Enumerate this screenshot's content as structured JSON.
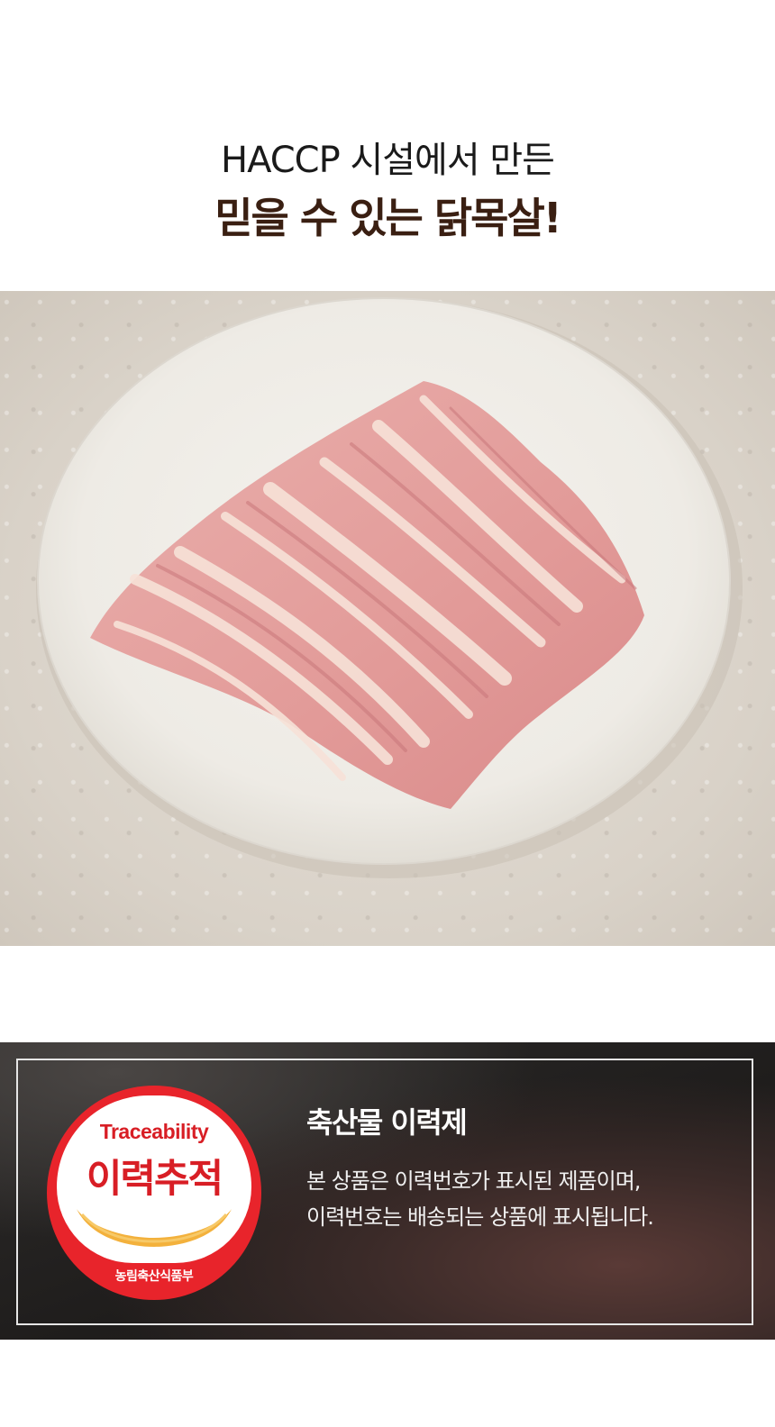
{
  "headline": {
    "line1": "HACCP 시설에서 만든",
    "line2": "믿을 수 있는 닭목살!"
  },
  "product_photo": {
    "icon": "chicken-neck-meat-on-plate-photo",
    "colors": {
      "plate": "#f3f1ec",
      "meat": "#e9a8a6",
      "fat": "#f6ddd2"
    }
  },
  "traceability": {
    "badge": {
      "english": "Traceability",
      "korean": "이력추적",
      "ministry": "농림축산식품부",
      "colors": {
        "red": "#e8242b",
        "gold": "#f3b13c"
      }
    },
    "title": "축산물 이력제",
    "description": [
      "본 상품은 이력번호가 표시된 제품이며,",
      "이력번호는 배송되는 상품에 표시됩니다."
    ]
  }
}
